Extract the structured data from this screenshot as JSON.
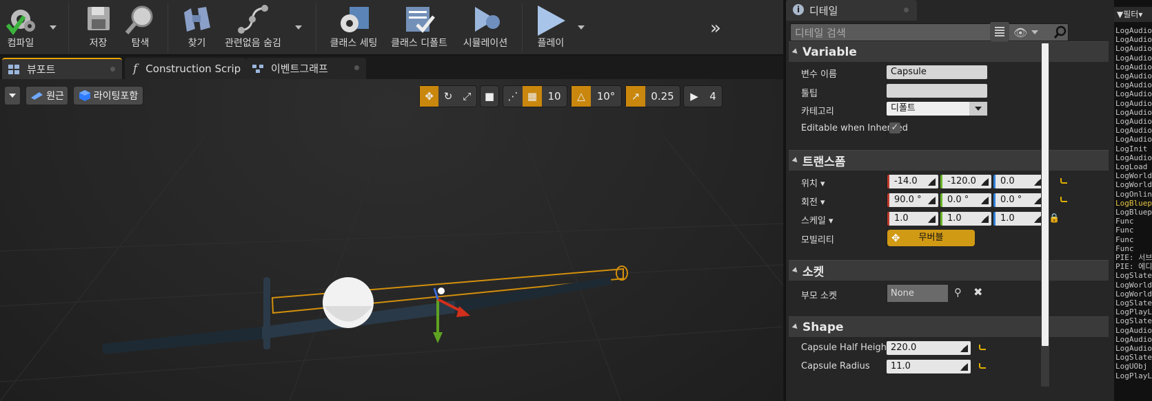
{
  "toolbar": {
    "buttons": [
      {
        "label": "컴파일"
      },
      {
        "label": "저장"
      },
      {
        "label": "탐색"
      },
      {
        "label": "찾기"
      },
      {
        "label": "관련없음 숨김"
      },
      {
        "label": "클래스 세팅"
      },
      {
        "label": "클래스 디폴트"
      },
      {
        "label": "시뮬레이션"
      },
      {
        "label": "플레이"
      }
    ],
    "overflow_icon": "chevron-double-right-icon"
  },
  "tabs": [
    {
      "label": "뷰포트",
      "icon": "viewport-icon",
      "active": true
    },
    {
      "label": "Construction Scrip",
      "icon": "function-icon",
      "active": false
    },
    {
      "label": "이벤트그래프",
      "icon": "graph-icon",
      "active": false
    }
  ],
  "viewport": {
    "perspective_label": "원근",
    "lighting_label": "라이팅포함",
    "grid_snap": "10",
    "rotation_snap": "10°",
    "scale_snap": "0.25",
    "camera_speed": "4"
  },
  "details": {
    "tab_label": "디테일",
    "search_placeholder": "디테일 검색",
    "sections": {
      "variable": {
        "title": "Variable",
        "var_name_label": "변수 이름",
        "var_name_value": "Capsule",
        "tooltip_label": "툴팁",
        "tooltip_value": "",
        "category_label": "카테고리",
        "category_value": "디폴트",
        "editable_label": "Editable when Inherited",
        "editable_checked": true
      },
      "transform": {
        "title": "트랜스폼",
        "location_label": "위치",
        "location": [
          "-14.0",
          "-120.0",
          "0.0"
        ],
        "rotation_label": "회전",
        "rotation": [
          "90.0 °",
          "0.0 °",
          "0.0 °"
        ],
        "scale_label": "스케일",
        "scale": [
          "1.0",
          "1.0",
          "1.0"
        ],
        "mobility_label": "모빌리티",
        "mobility_value": "무버블"
      },
      "socket": {
        "title": "소켓",
        "parent_socket_label": "부모 소켓",
        "parent_socket_value": "None"
      },
      "shape": {
        "title": "Shape",
        "half_height_label": "Capsule Half Height",
        "half_height_value": "220.0",
        "radius_label": "Capsule Radius",
        "radius_value": "11.0"
      }
    }
  },
  "log": {
    "filter_label": "필터",
    "lines": [
      "LogAudio",
      "LogAudio",
      "LogAudio",
      "LogAudio",
      "LogAudio",
      "LogAudio",
      "LogAudio",
      "LogAudio",
      "LogAudio",
      "LogAudio",
      "LogAudio",
      "LogAudio",
      "LogAudio",
      "LogInit",
      "LogAudio",
      "LogLoad",
      "LogWorld",
      "LogWorld",
      "LogOnlin",
      "LogBluep",
      "LogBluep",
      "  Func",
      "  Func",
      "  Func",
      "  Func",
      "PIE: 서브",
      "PIE: 에디",
      "LogSlate",
      "LogWorld",
      "LogWorld",
      "LogSlate",
      "LogPlayL",
      "LogSlate",
      "LogAudio",
      "LogAudio",
      "LogAudio",
      "LogSlate",
      "LogUObj",
      "LogPlayL"
    ],
    "highlight_color": "#e5c542"
  }
}
